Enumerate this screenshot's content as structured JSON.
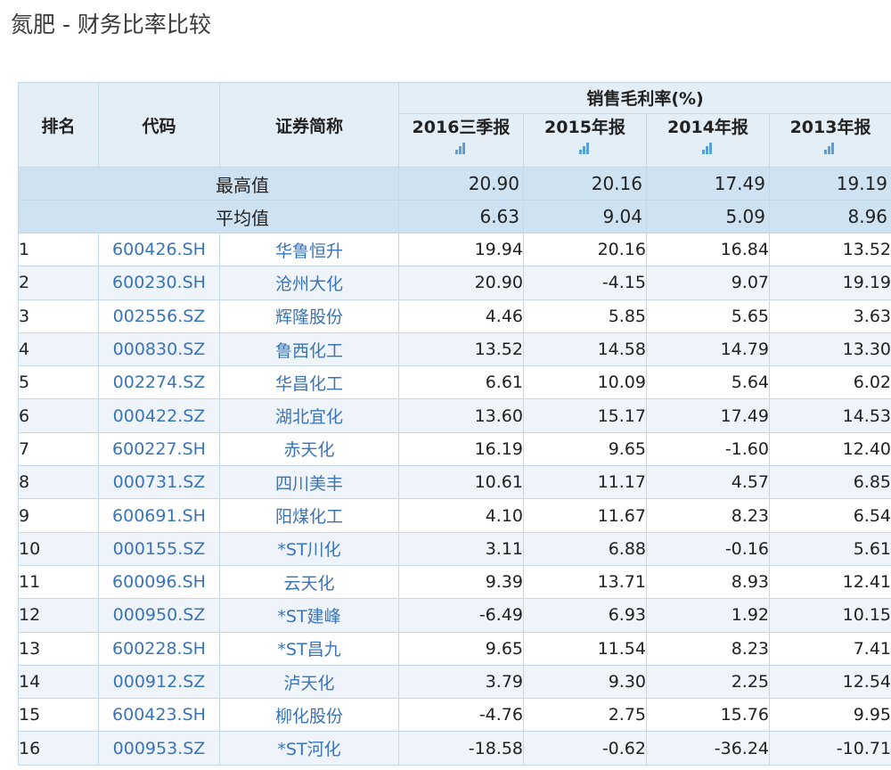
{
  "page": {
    "title": "氮肥 - 财务比率比较"
  },
  "table": {
    "headers": {
      "rank": "排名",
      "code": "代码",
      "name": "证券简称",
      "group": "销售毛利率(%)"
    },
    "periods": [
      "2016三季报",
      "2015年报",
      "2014年报",
      "2013年报"
    ],
    "period_icon": "bar-chart-icon",
    "summary": [
      {
        "label": "最高值",
        "values": [
          "20.90",
          "20.16",
          "17.49",
          "19.19"
        ]
      },
      {
        "label": "平均值",
        "values": [
          "6.63",
          "9.04",
          "5.09",
          "8.96"
        ]
      }
    ],
    "rows": [
      {
        "rank": "1",
        "code": "600426.SH",
        "name": "华鲁恒升",
        "values": [
          "19.94",
          "20.16",
          "16.84",
          "13.52"
        ]
      },
      {
        "rank": "2",
        "code": "600230.SH",
        "name": "沧州大化",
        "values": [
          "20.90",
          "-4.15",
          "9.07",
          "19.19"
        ]
      },
      {
        "rank": "3",
        "code": "002556.SZ",
        "name": "辉隆股份",
        "values": [
          "4.46",
          "5.85",
          "5.65",
          "3.63"
        ]
      },
      {
        "rank": "4",
        "code": "000830.SZ",
        "name": "鲁西化工",
        "values": [
          "13.52",
          "14.58",
          "14.79",
          "13.30"
        ]
      },
      {
        "rank": "5",
        "code": "002274.SZ",
        "name": "华昌化工",
        "values": [
          "6.61",
          "10.09",
          "5.64",
          "6.02"
        ]
      },
      {
        "rank": "6",
        "code": "000422.SZ",
        "name": "湖北宜化",
        "values": [
          "13.60",
          "15.17",
          "17.49",
          "14.53"
        ]
      },
      {
        "rank": "7",
        "code": "600227.SH",
        "name": "赤天化",
        "values": [
          "16.19",
          "9.65",
          "-1.60",
          "12.40"
        ]
      },
      {
        "rank": "8",
        "code": "000731.SZ",
        "name": "四川美丰",
        "values": [
          "10.61",
          "11.17",
          "4.57",
          "6.85"
        ]
      },
      {
        "rank": "9",
        "code": "600691.SH",
        "name": "阳煤化工",
        "values": [
          "4.10",
          "11.67",
          "8.23",
          "6.54"
        ]
      },
      {
        "rank": "10",
        "code": "000155.SZ",
        "name": "*ST川化",
        "values": [
          "3.11",
          "6.88",
          "-0.16",
          "5.61"
        ]
      },
      {
        "rank": "11",
        "code": "600096.SH",
        "name": "云天化",
        "values": [
          "9.39",
          "13.71",
          "8.93",
          "12.41"
        ]
      },
      {
        "rank": "12",
        "code": "000950.SZ",
        "name": "*ST建峰",
        "values": [
          "-6.49",
          "6.93",
          "1.92",
          "10.15"
        ]
      },
      {
        "rank": "13",
        "code": "600228.SH",
        "name": "*ST昌九",
        "values": [
          "9.65",
          "11.54",
          "8.23",
          "7.41"
        ]
      },
      {
        "rank": "14",
        "code": "000912.SZ",
        "name": "泸天化",
        "values": [
          "3.79",
          "9.30",
          "2.25",
          "12.54"
        ]
      },
      {
        "rank": "15",
        "code": "600423.SH",
        "name": "柳化股份",
        "values": [
          "-4.76",
          "2.75",
          "15.76",
          "9.95"
        ]
      },
      {
        "rank": "16",
        "code": "000953.SZ",
        "name": "*ST河化",
        "values": [
          "-18.58",
          "-0.62",
          "-36.24",
          "-10.71"
        ]
      }
    ]
  }
}
